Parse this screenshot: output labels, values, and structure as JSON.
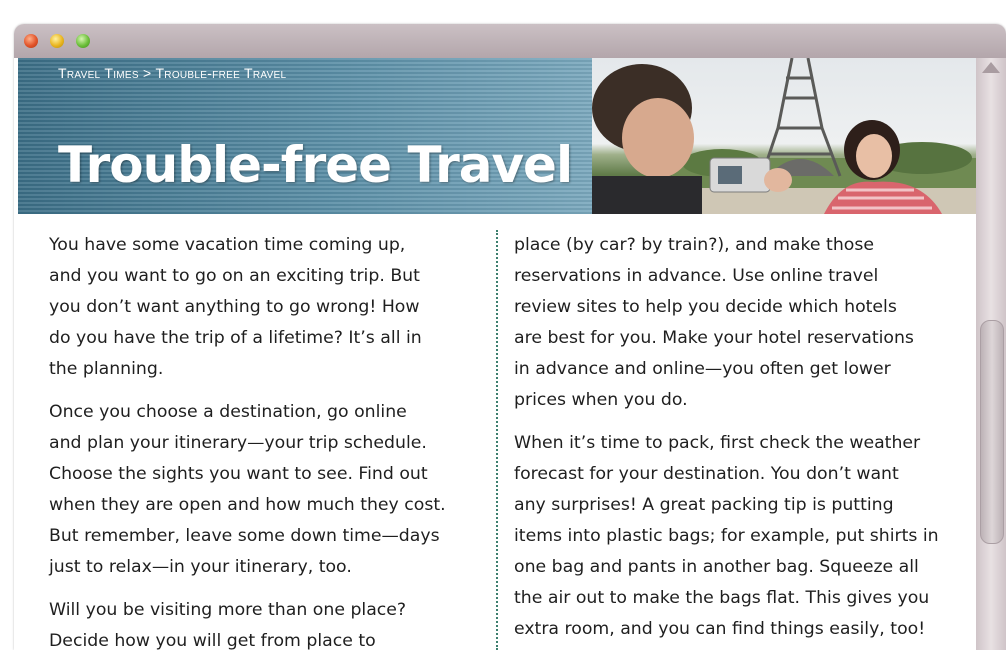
{
  "colors": {
    "banner": "#4f849c",
    "divider": "#3d7f6e",
    "text": "#1f1f1f"
  },
  "window": {
    "traffic_lights": [
      "close-icon",
      "minimize-icon",
      "zoom-icon"
    ]
  },
  "header": {
    "breadcrumb": "Travel Times > Trouble-free Travel",
    "title": "Trouble-free Travel"
  },
  "article": {
    "left_column": [
      [
        "You have some vacation time coming up,",
        "and you want to go on an exciting trip. But",
        "you don’t want anything to go wrong! How",
        "do you have the trip of a lifetime? It’s all in",
        "the planning."
      ],
      [
        "Once you choose a destination, go online",
        "and plan your itinerary—your trip schedule.",
        "Choose the sights you want to see. Find out",
        "when they are open and how much they cost.",
        "But remember, leave some down time—days",
        "just to relax—in your itinerary, too."
      ],
      [
        "Will you be visiting more than one place?",
        "Decide how you will get from place to"
      ]
    ],
    "right_column": [
      [
        "place (by car? by train?), and make those",
        "reservations in advance. Use online travel",
        "review sites to help you decide which hotels",
        "are best for you. Make your hotel reservations",
        "in advance and online—you often get lower",
        "prices when you do."
      ],
      [
        "When it’s time to pack, first check the weather",
        "forecast for your destination. You don’t want",
        "any surprises! A great packing tip is putting",
        "items into plastic bags; for example, put shirts in",
        "one bag and pants in another bag. Squeeze all",
        "the air out to make the bags flat. This gives you",
        "extra room, and you can find things easily, too!"
      ]
    ]
  }
}
